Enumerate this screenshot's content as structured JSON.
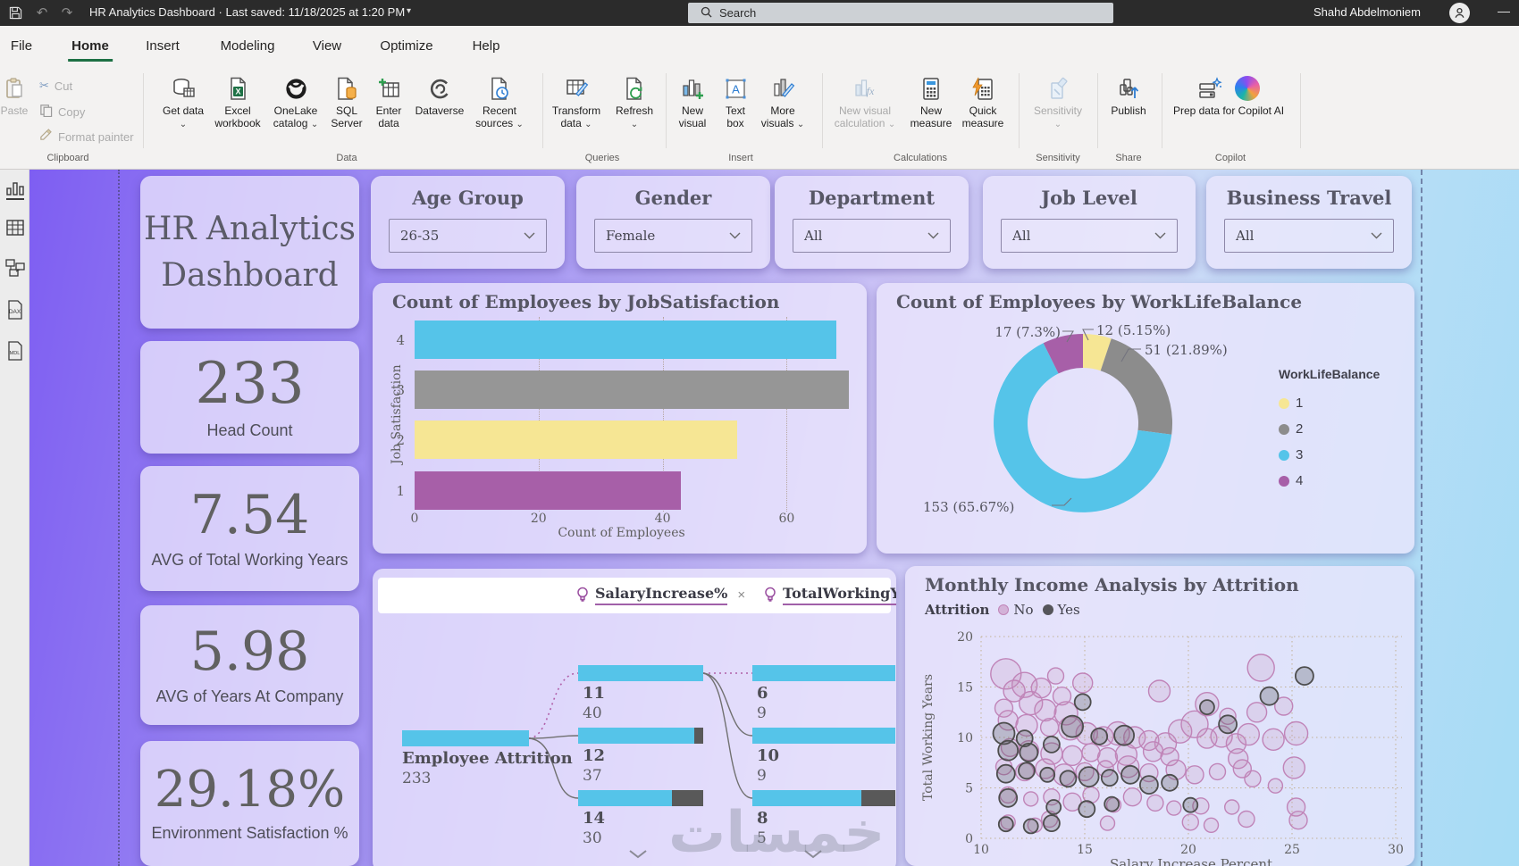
{
  "titlebar": {
    "title": "HR Analytics Dashboard",
    "separator": "·",
    "saved": "Last saved: 11/18/2025 at 1:20 PM",
    "search_placeholder": "Search",
    "user": "Shahd Abdelmoniem"
  },
  "menu": {
    "items": [
      "File",
      "Home",
      "Insert",
      "Modeling",
      "View",
      "Optimize",
      "Help"
    ],
    "active": "Home"
  },
  "ribbon": {
    "groups": {
      "clipboard": "Clipboard",
      "data": "Data",
      "queries": "Queries",
      "insert": "Insert",
      "calculations": "Calculations",
      "sensitivity": "Sensitivity",
      "share": "Share",
      "copilot": "Copilot"
    },
    "buttons": {
      "paste": "Paste",
      "cut": "Cut",
      "copy": "Copy",
      "format_painter": "Format painter",
      "get_data": "Get data",
      "excel_workbook": "Excel workbook",
      "onelake_catalog": "OneLake catalog",
      "sql_server": "SQL Server",
      "enter_data": "Enter data",
      "dataverse": "Dataverse",
      "recent_sources": "Recent sources",
      "transform_data": "Transform data",
      "refresh": "Refresh",
      "new_visual": "New visual",
      "text_box": "Text box",
      "more_visuals": "More visuals",
      "new_visual_calculation": "New visual calculation",
      "new_measure": "New measure",
      "quick_measure": "Quick measure",
      "sensitivity": "Sensitivity",
      "publish": "Publish",
      "prep_copilot": "Prep data for Copilot AI"
    }
  },
  "sidebar": {
    "icons": [
      "report-view",
      "table-view",
      "model-view",
      "dax-query-view",
      "tmdl-view"
    ]
  },
  "dashboard": {
    "title_card": "HR Analytics Dashboard",
    "kpis": [
      {
        "value": "233",
        "label": "Head Count"
      },
      {
        "value": "7.54",
        "label": "AVG of Total Working Years"
      },
      {
        "value": "5.98",
        "label": "AVG of Years At Company"
      },
      {
        "value": "29.18%",
        "label": "Environment Satisfaction %"
      }
    ],
    "filters": [
      {
        "title": "Age Group",
        "value": "26-35"
      },
      {
        "title": "Gender",
        "value": "Female"
      },
      {
        "title": "Department",
        "value": "All"
      },
      {
        "title": "Job Level",
        "value": "All"
      },
      {
        "title": "Business Travel",
        "value": "All"
      }
    ],
    "watermark": "خمسات"
  },
  "chart_data": [
    {
      "id": "job_satisfaction_bar",
      "type": "bar",
      "orientation": "horizontal",
      "title": "Count of Employees by JobSatisfaction",
      "categories": [
        "4",
        "3",
        "2",
        "1"
      ],
      "values": [
        68,
        70,
        52,
        43
      ],
      "bar_colors": [
        "#55c4e9",
        "#969696",
        "#f6e694",
        "#a75fa8"
      ],
      "xlabel": "Count of Employees",
      "ylabel": "Job Satisfaction",
      "xticks": [
        0,
        20,
        40,
        60
      ],
      "xlim": [
        0,
        72
      ],
      "grid": true
    },
    {
      "id": "worklife_donut",
      "type": "pie",
      "donut": true,
      "title": "Count of Employees by WorkLifeBalance",
      "legend_title": "WorkLifeBalance",
      "legend_position": "right",
      "labels": [
        "1",
        "2",
        "3",
        "4"
      ],
      "values": [
        12,
        51,
        153,
        17
      ],
      "data_labels": [
        "12 (5.15%)",
        "51 (21.89%)",
        "153 (65.67%)",
        "17 (7.3%)"
      ],
      "colors": [
        "#f6e694",
        "#8c8c8c",
        "#55c4e9",
        "#a75fa8"
      ]
    },
    {
      "id": "attrition_decomposition_tree",
      "type": "tree",
      "fields": [
        "SalaryIncrease%",
        "TotalWorkingYe…"
      ],
      "root": {
        "label": "Employee Attrition",
        "value": "233"
      },
      "level1": [
        {
          "key": "11",
          "value": "40",
          "attrition_ratio": 0
        },
        {
          "key": "12",
          "value": "37",
          "attrition_ratio": 0.07
        },
        {
          "key": "14",
          "value": "30",
          "attrition_ratio": 0.25
        }
      ],
      "level2": [
        {
          "key": "6",
          "value": "9",
          "attrition_ratio": 0
        },
        {
          "key": "10",
          "value": "9",
          "attrition_ratio": 0
        },
        {
          "key": "8",
          "value": "5",
          "attrition_ratio": 0.24
        }
      ]
    },
    {
      "id": "income_scatter",
      "type": "scatter",
      "title": "Monthly Income Analysis by Attrition",
      "legend_title": "Attrition",
      "xlabel": "Salary Increase Percent",
      "ylabel": "Total Working Years",
      "xticks": [
        10,
        15,
        20,
        25,
        30
      ],
      "yticks": [
        0,
        5,
        10,
        15,
        20
      ],
      "xlim": [
        9.5,
        31
      ],
      "ylim": [
        0,
        20
      ],
      "grid": true,
      "series": [
        {
          "name": "No",
          "color": "#c084b8",
          "fill": "rgba(196,140,187,0.20)",
          "points": [
            [
              11.2,
              16.3,
              17
            ],
            [
              12.1,
              15.2,
              14
            ],
            [
              12.9,
              14.9,
              11
            ],
            [
              13.6,
              16.1,
              9
            ],
            [
              11.6,
              14.6,
              12
            ],
            [
              12.4,
              13.4,
              13
            ],
            [
              11.1,
              12.9,
              10
            ],
            [
              13.1,
              12.7,
              12
            ],
            [
              14.1,
              12.4,
              13
            ],
            [
              11.3,
              11.7,
              11
            ],
            [
              12.2,
              11.2,
              12
            ],
            [
              13.3,
              11,
              10
            ],
            [
              14.3,
              10.9,
              13
            ],
            [
              15.1,
              10.4,
              12
            ],
            [
              15.9,
              10.1,
              11
            ],
            [
              16.6,
              10.4,
              13
            ],
            [
              17.4,
              10,
              12
            ],
            [
              18.1,
              9.7,
              11
            ],
            [
              18.9,
              9.4,
              12
            ],
            [
              19.6,
              10.6,
              13
            ],
            [
              20.3,
              11.3,
              15
            ],
            [
              20.9,
              9.9,
              11
            ],
            [
              21.6,
              10.1,
              12
            ],
            [
              22.3,
              9.4,
              11
            ],
            [
              22.9,
              10.3,
              12
            ],
            [
              23.3,
              12.5,
              11
            ],
            [
              24.1,
              9.8,
              12
            ],
            [
              25.2,
              10.4,
              13
            ],
            [
              11.4,
              9,
              10
            ],
            [
              12.3,
              8.7,
              11
            ],
            [
              13.4,
              8.4,
              12
            ],
            [
              14.4,
              8.2,
              11
            ],
            [
              15.3,
              8.5,
              10
            ],
            [
              16.1,
              8,
              11
            ],
            [
              17,
              8.3,
              12
            ],
            [
              18.3,
              8.6,
              11
            ],
            [
              19.1,
              8.1,
              10
            ],
            [
              11.1,
              7.1,
              9
            ],
            [
              12.1,
              6.6,
              10
            ],
            [
              13.1,
              6.9,
              11
            ],
            [
              14,
              6.3,
              12
            ],
            [
              15,
              6.6,
              10
            ],
            [
              16,
              6.9,
              9
            ],
            [
              17.1,
              7.1,
              12
            ],
            [
              18.1,
              6.5,
              10
            ],
            [
              19.4,
              6.8,
              11
            ],
            [
              20.3,
              6.3,
              10
            ],
            [
              21.4,
              6.6,
              9
            ],
            [
              22.6,
              6.9,
              10
            ],
            [
              25.1,
              7,
              12
            ],
            [
              11.3,
              4.3,
              9
            ],
            [
              12.4,
              3.9,
              8
            ],
            [
              13.4,
              4.1,
              9
            ],
            [
              14.4,
              3.6,
              10
            ],
            [
              15.3,
              4.3,
              9
            ],
            [
              16.4,
              3.3,
              8
            ],
            [
              17.3,
              4.1,
              10
            ],
            [
              18.4,
              3.5,
              9
            ],
            [
              19.3,
              3,
              8
            ],
            [
              20.6,
              3.2,
              9
            ],
            [
              22.1,
              3.1,
              8
            ],
            [
              25.2,
              3.1,
              10
            ],
            [
              11.3,
              1.6,
              8
            ],
            [
              12.6,
              1.3,
              8
            ],
            [
              13.3,
              1.9,
              9
            ],
            [
              16.1,
              1.5,
              8
            ],
            [
              20.1,
              1.6,
              9
            ],
            [
              21.1,
              1.3,
              8
            ],
            [
              23.5,
              16.9,
              15
            ],
            [
              18.6,
              14.6,
              12
            ],
            [
              20.9,
              13.3,
              13
            ],
            [
              22.4,
              7.9,
              11
            ],
            [
              24.6,
              13.1,
              10
            ],
            [
              14.9,
              15.4,
              11
            ],
            [
              13.9,
              14.1,
              10
            ],
            [
              21.9,
              12.1,
              9
            ],
            [
              23.1,
              5.9,
              9
            ],
            [
              24.2,
              5.2,
              8
            ],
            [
              22.8,
              1.9,
              9
            ],
            [
              25.3,
              1.8,
              10
            ]
          ]
        },
        {
          "name": "Yes",
          "color": "#4d4d4d",
          "fill": "rgba(90,90,95,0.30)",
          "points": [
            [
              11.1,
              10.4,
              12
            ],
            [
              11.3,
              8.7,
              11
            ],
            [
              12.1,
              9.9,
              9
            ],
            [
              12.3,
              8.5,
              10
            ],
            [
              13.4,
              9.3,
              9
            ],
            [
              14.4,
              11.1,
              12
            ],
            [
              15.7,
              10.1,
              9
            ],
            [
              16.9,
              10.2,
              11
            ],
            [
              11.2,
              6.4,
              10
            ],
            [
              12.2,
              6.7,
              9
            ],
            [
              13.2,
              6.3,
              8
            ],
            [
              14.2,
              5.9,
              9
            ],
            [
              15.2,
              6.1,
              11
            ],
            [
              16.2,
              6,
              9
            ],
            [
              17.2,
              6.3,
              10
            ],
            [
              18.1,
              5.3,
              10
            ],
            [
              19.1,
              5.5,
              9
            ],
            [
              11.3,
              4,
              10
            ],
            [
              13.5,
              3.1,
              8
            ],
            [
              15.1,
              2.9,
              9
            ],
            [
              16.3,
              3.4,
              8
            ],
            [
              20.1,
              3.3,
              8
            ],
            [
              11.2,
              1.4,
              8
            ],
            [
              12.4,
              1.2,
              8
            ],
            [
              13.4,
              1.5,
              9
            ],
            [
              25.6,
              16.1,
              10
            ],
            [
              23.9,
              14.1,
              10
            ],
            [
              20.9,
              13,
              8
            ],
            [
              21.9,
              11.3,
              10
            ],
            [
              14.9,
              13.5,
              9
            ]
          ]
        }
      ]
    }
  ]
}
